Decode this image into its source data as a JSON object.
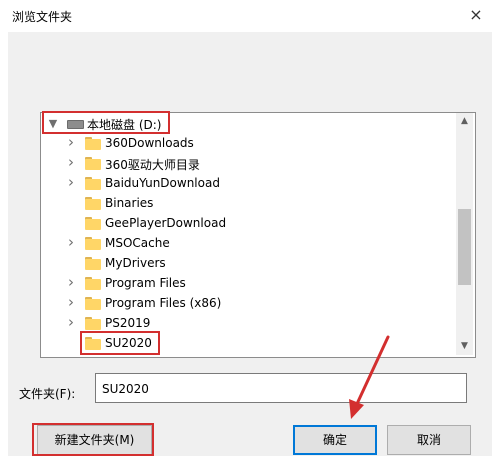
{
  "window": {
    "title": "浏览文件夹",
    "close_glyph": "×"
  },
  "tree": {
    "drive": {
      "label": "本地磁盘 (D:)",
      "expanded": true
    },
    "items": [
      {
        "label": "360Downloads",
        "has_children": true
      },
      {
        "label": "360驱动大师目录",
        "has_children": true
      },
      {
        "label": "BaiduYunDownload",
        "has_children": true
      },
      {
        "label": "Binaries",
        "has_children": false
      },
      {
        "label": "GeePlayerDownload",
        "has_children": false
      },
      {
        "label": "MSOCache",
        "has_children": true
      },
      {
        "label": "MyDrivers",
        "has_children": false
      },
      {
        "label": "Program Files",
        "has_children": true
      },
      {
        "label": "Program Files (x86)",
        "has_children": true
      },
      {
        "label": "PS2019",
        "has_children": true
      },
      {
        "label": "SU2020",
        "has_children": false,
        "selected": true
      }
    ]
  },
  "folder_field": {
    "label": "文件夹(F):",
    "value": "SU2020"
  },
  "buttons": {
    "new_folder": "新建文件夹(M)",
    "ok": "确定",
    "cancel": "取消"
  },
  "annotations": {
    "highlight_color": "#d32f2f"
  },
  "icons": {
    "expand": "chevron-right-icon",
    "collapse": "chevron-down-icon",
    "folder": "folder-icon",
    "drive": "drive-icon"
  }
}
